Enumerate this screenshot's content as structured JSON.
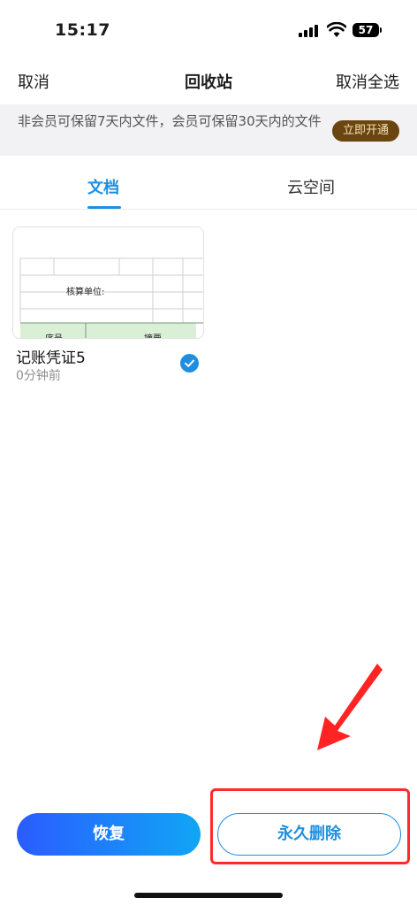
{
  "status_bar": {
    "time": "15:17",
    "battery": "57"
  },
  "nav": {
    "cancel": "取消",
    "title": "回收站",
    "deselect_all": "取消全选"
  },
  "banner": {
    "text": "非会员可保留7天内文件，会员可保留30天内的文件",
    "cta": "立即开通",
    "cta_color": "#6b4510"
  },
  "tabs": [
    {
      "label": "文档",
      "active": true
    },
    {
      "label": "云空间",
      "active": false
    }
  ],
  "files": [
    {
      "name": "记账凭证5",
      "time": "0分钟前",
      "selected": true,
      "thumbnail": {
        "label": "核算单位:",
        "col1": "序号",
        "col2": "摘要"
      }
    }
  ],
  "actions": {
    "restore": "恢复",
    "delete_forever": "永久删除"
  },
  "colors": {
    "accent": "#1e8fe0",
    "annotation": "#ff2b2b"
  }
}
